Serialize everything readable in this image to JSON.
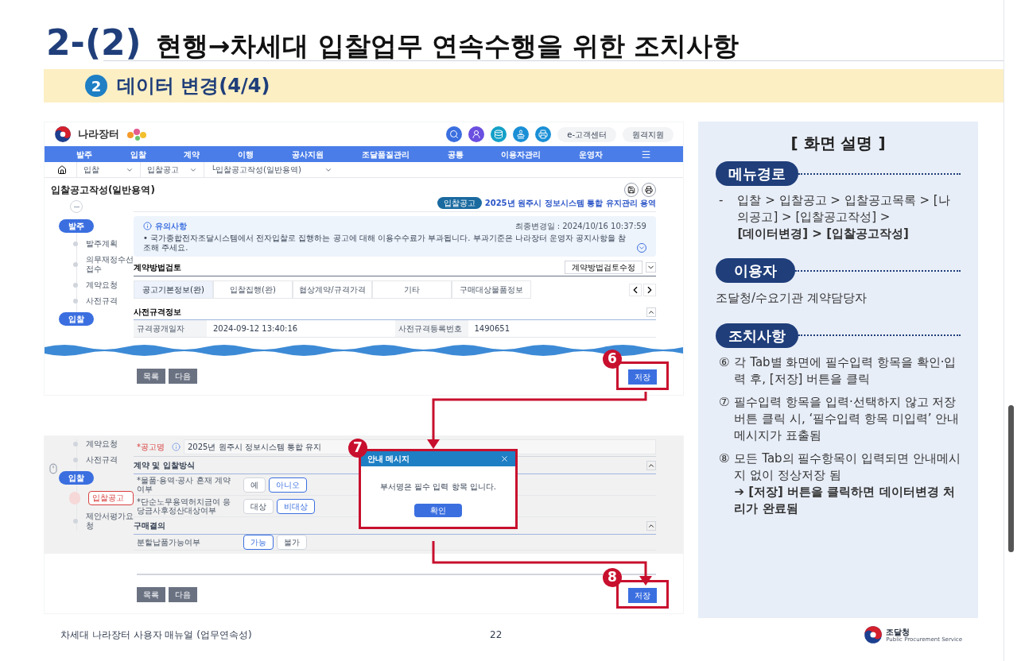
{
  "header": {
    "number": "2-(2)",
    "title": "현행→차세대 입찰업무 연속수행을 위한 조치사항"
  },
  "section": {
    "badge": "2",
    "title": "데이터 변경(4/4)"
  },
  "screen_top": {
    "logo_text": "나라장터",
    "header_buttons": [
      "e-고객센터",
      "원격지원"
    ],
    "nav": [
      "발주",
      "입찰",
      "계약",
      "이행",
      "공사지원",
      "조달품질관리",
      "공통",
      "이용자관리",
      "운영자"
    ],
    "breadcrumb": [
      "입찰",
      "입찰공고",
      "└입찰공고작성(일반용역)"
    ],
    "page_title": "입찰공고작성(일반용역)",
    "steps": [
      {
        "kind": "stage",
        "label": "발주"
      },
      {
        "kind": "step",
        "label": "발주계획",
        "selected": false
      },
      {
        "kind": "step",
        "label": "의무재정수선접수",
        "selected": false
      },
      {
        "kind": "step",
        "label": "계약요청",
        "selected": false
      },
      {
        "kind": "step",
        "label": "사전규격",
        "selected": false
      },
      {
        "kind": "stage",
        "label": "입찰"
      }
    ],
    "tag": "입찰공고",
    "notice_name": "2025년 원주시 정보시스템 통합 유지관리 용역",
    "notice": {
      "title": "유의사항",
      "updated": "최종변경일 : 2024/10/16 10:37:59",
      "text": "• 국가종합전자조달시스템에서 전자입찰로 집행하는 공고에 대해 이용수수료가 부과됩니다. 부과기준은 나라장터 운영자 공지사항을 참조해 주세요."
    },
    "review_title": "계약방법검토",
    "review_button": "계약방법검토수정",
    "tabs": [
      {
        "label": "공고기본정보(완)",
        "selected": true
      },
      {
        "label": "입찰집행(완)",
        "selected": false
      },
      {
        "label": "협상계약/규격가격",
        "selected": false
      },
      {
        "label": "기타",
        "selected": false
      },
      {
        "label": "구매대상물품정보",
        "selected": false
      }
    ],
    "spec_title": "사전규격정보",
    "fields": [
      {
        "label": "규격공개일자",
        "value": "2024-09-12 13:40:16"
      },
      {
        "label": "사전규격등록번호",
        "value": "1490651"
      }
    ],
    "buttons": [
      "목록",
      "다음"
    ],
    "save": "저장",
    "marker": "6"
  },
  "screen_bottom": {
    "steps": [
      {
        "kind": "step",
        "label": "계약요청",
        "selected": false
      },
      {
        "kind": "step",
        "label": "사전규격",
        "selected": false
      },
      {
        "kind": "stage",
        "label": "입찰"
      },
      {
        "kind": "step",
        "label": "입찰공고",
        "selected": true
      },
      {
        "kind": "step",
        "label": "제안서평가요청",
        "selected": false
      }
    ],
    "name_field": {
      "label": "*공고명",
      "value": "2025년 원주시 정보시스템 통합 유지"
    },
    "method_title": "계약 및 입찰방식",
    "options": [
      {
        "label": "*물품·용역·공사 혼재 계약여부",
        "choices": [
          {
            "label": "예",
            "selected": false
          },
          {
            "label": "아니오",
            "selected": true
          }
        ]
      },
      {
        "label": "*단순노무용역허치금여 응당금사후정산대상여부",
        "choices": [
          {
            "label": "대상",
            "selected": false
          },
          {
            "label": "비대상",
            "selected": true
          }
        ]
      }
    ],
    "purchase_title": "구매결의",
    "purchase_options": [
      {
        "label": "분할납품가능여부",
        "choices": [
          {
            "label": "가능",
            "selected": true
          },
          {
            "label": "불가",
            "selected": false
          }
        ]
      }
    ],
    "dialog": {
      "title": "안내 메시지",
      "message": "부서명은 필수 입력 항목 입니다.",
      "button": "확인",
      "marker": "7"
    },
    "buttons": [
      "목록",
      "다음"
    ],
    "save": "저장",
    "marker": "8"
  },
  "panel": {
    "title": "[ 화면 설명 ]",
    "menu": {
      "heading": "메뉴경로",
      "bullet": "-",
      "text": "입찰 > 입찰공고 > 입찰공고목록 > [나의공고] > [입찰공고작성] >",
      "emphasis": "[데이터변경] > [입찰공고작성]"
    },
    "user": {
      "heading": "이용자",
      "text": "조달청/수요기관 계약담당자"
    },
    "actions": {
      "heading": "조치사항",
      "items": [
        {
          "marker": "⑥",
          "text": "각 Tab별 화면에 필수입력 항목을 확인·입력 후, [저장] 버튼을 클릭"
        },
        {
          "marker": "⑦",
          "text": "필수입력 항목을 입력·선택하지 않고 저장 버튼 클릭 시, ‘필수입력 항목 미입력’ 안내 메시지가 표출됨"
        },
        {
          "marker": "⑧",
          "text": "모든 Tab의 필수항목이 입력되면 안내메시지 없이 정상저장 됨",
          "emphasis": "➔ [저장] 버튼을 클릭하면 데이터변경 처리가 완료됨"
        }
      ]
    }
  },
  "footer": {
    "text": "차세대 나라장터 사용자 매뉴얼 (업무연속성)",
    "page": "22",
    "logo_text": "조달청",
    "logo_subtext": "Public Procurement Service"
  }
}
